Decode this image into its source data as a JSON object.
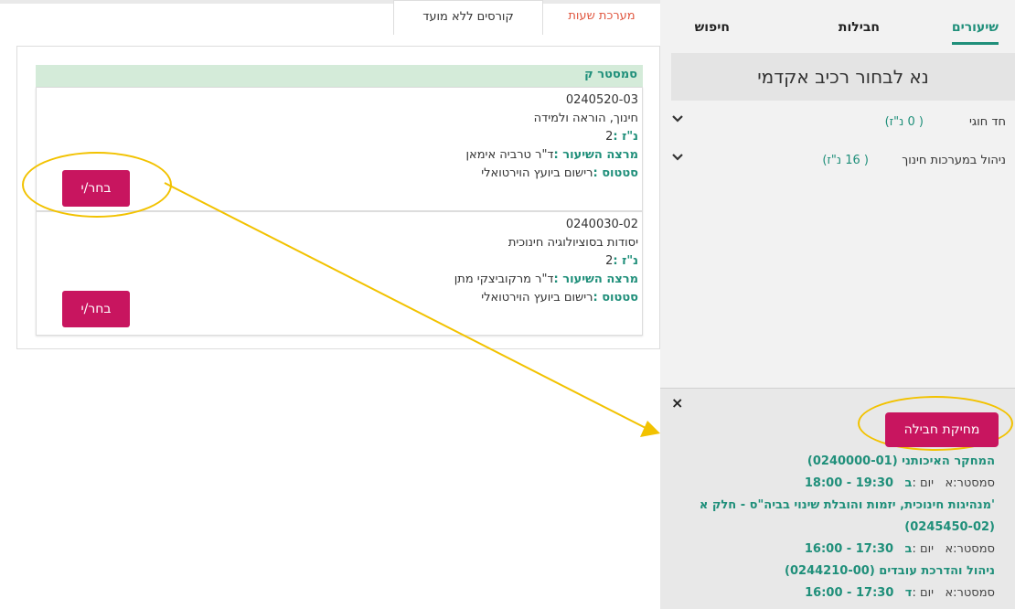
{
  "nav": {
    "tabs": [
      {
        "label": "שיעורים",
        "active": true
      },
      {
        "label": "חבילות",
        "active": false
      },
      {
        "label": "חיפוש",
        "active": false
      }
    ]
  },
  "left_tabs": [
    {
      "label": "מערכת שעות"
    },
    {
      "label": "קורסים ללא מועד"
    }
  ],
  "right_panel": {
    "title": "נא לבחור רכיב אקדמי",
    "items": [
      {
        "name": "חד חוגי",
        "credits": "( 0 נ\"ז)"
      },
      {
        "name": "ניהול במערכות חינוך",
        "credits": "( 16 נ\"ז)"
      }
    ]
  },
  "semester": {
    "label": "סמסטר ק"
  },
  "labels": {
    "credits": "נ\"ז :",
    "lecturer": "מרצה השיעור :",
    "status": "סטטוס :",
    "choose": "בחר/י"
  },
  "courses": [
    {
      "code": "0240520-03",
      "name": "חינוך, הוראה ולמידה",
      "credits": "2",
      "lecturer": "ד\"ר טרביה אימאן",
      "status": "רישום ביועץ הוירטואלי"
    },
    {
      "code": "0240030-02",
      "name": "יסודות בסוציולוגיה חינוכית",
      "credits": "2",
      "lecturer": "ד\"ר מרקוביצקי מתן",
      "status": "רישום ביועץ הוירטואלי"
    }
  ],
  "basket": {
    "close": "×",
    "delete_label": "מחיקת חבילה",
    "sem_label": "סמסטר:",
    "day_label": "יום :",
    "items": [
      {
        "name": "המחקר האיכותני (0240000-01)",
        "sem": "א",
        "day": "ב",
        "time": "19:30 - 18:00"
      },
      {
        "name": "'מנהיגות חינוכית, יזמות והובלת שינוי בביה\"ס - חלק א (0245450-02)",
        "sem": "א",
        "day": "ב",
        "time": "17:30 - 16:00"
      },
      {
        "name": "ניהול והדרכת עובדים (0244210-00)",
        "sem": "א",
        "day": "ד",
        "time": "17:30 - 16:00"
      }
    ]
  },
  "colors": {
    "accent": "#1f8f7a",
    "button": "#c8155f",
    "highlight": "#f2c200",
    "tab_red": "#e0563f"
  },
  "icons": [
    "chevron-down-icon",
    "close-icon",
    "arrow-annotation"
  ]
}
